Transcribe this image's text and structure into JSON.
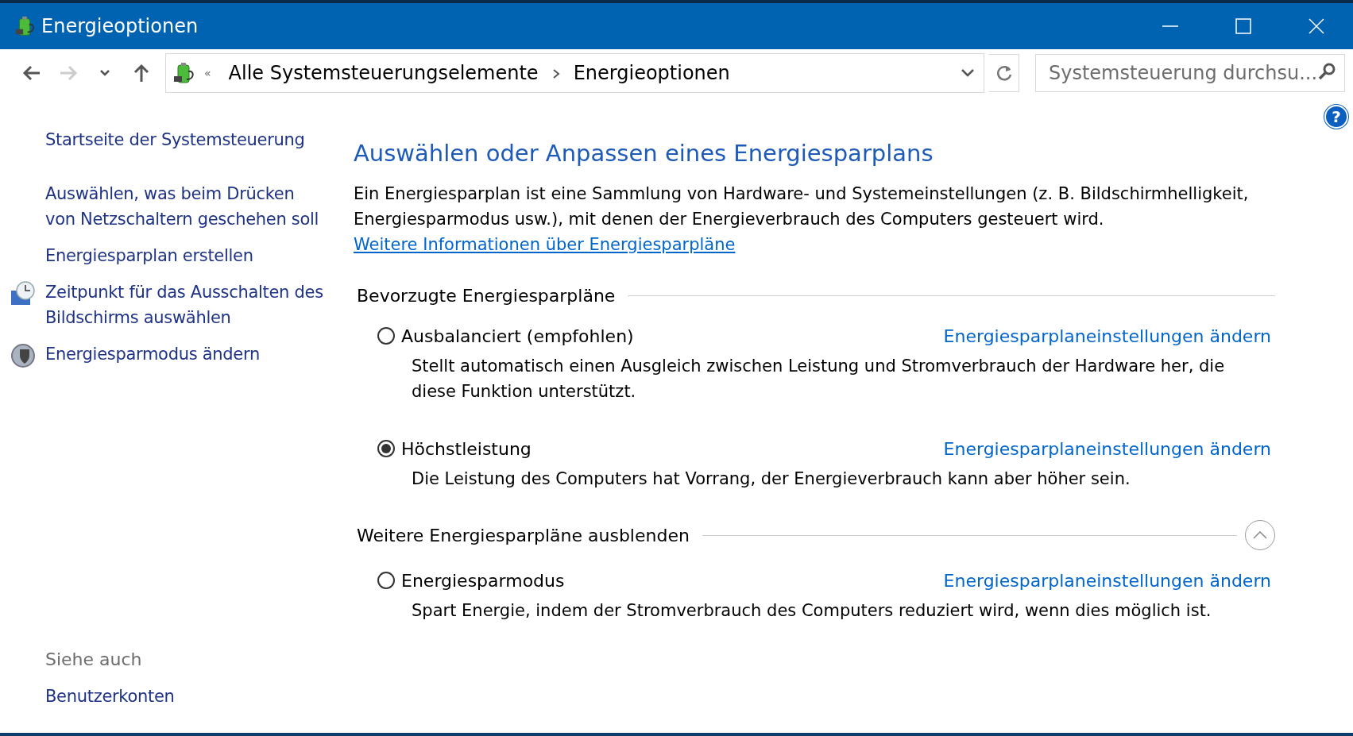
{
  "window": {
    "title": "Energieoptionen"
  },
  "address_bar": {
    "overflow": "«",
    "crumbs": [
      "Alle Systemsteuerungselemente",
      "Energieoptionen"
    ]
  },
  "search": {
    "placeholder": "Systemsteuerung durchsu..."
  },
  "help": {
    "label": "?"
  },
  "sidebar": {
    "items": [
      {
        "label": "Startseite der Systemsteuerung",
        "kind": "link"
      },
      {
        "label": "Auswählen, was beim Drücken von Netzschaltern geschehen soll",
        "kind": "link"
      },
      {
        "label": "Energiesparplan erstellen",
        "kind": "link"
      },
      {
        "label": "Zeitpunkt für das Ausschalten des Bildschirms auswählen",
        "kind": "clock-link"
      },
      {
        "label": "Energiesparmodus ändern",
        "kind": "mode-link"
      }
    ],
    "see_also": {
      "heading": "Siehe auch",
      "items": [
        "Benutzerkonten"
      ]
    }
  },
  "main": {
    "heading": "Auswählen oder Anpassen eines Energiesparplans",
    "intro": "Ein Energiesparplan ist eine Sammlung von Hardware- und Systemeinstellungen (z. B. Bildschirmhelligkeit, Energiesparmodus usw.), mit denen der Energieverbrauch des Computers gesteuert wird. ",
    "intro_link": "Weitere Informationen über Energiesparpläne",
    "groups": [
      {
        "title": "Bevorzugte Energiesparpläne",
        "plans": [
          {
            "name": "Ausbalanciert (empfohlen)",
            "selected": false,
            "link": "Energiesparplaneinstellungen ändern",
            "description": "Stellt automatisch einen Ausgleich zwischen Leistung und Stromverbrauch der Hardware her, die diese Funktion unterstützt."
          },
          {
            "name": "Höchstleistung",
            "selected": true,
            "link": "Energiesparplaneinstellungen ändern",
            "description": "Die Leistung des Computers hat Vorrang, der Energieverbrauch kann aber höher sein."
          }
        ]
      },
      {
        "title": "Weitere Energiesparpläne ausblenden",
        "expanded": true,
        "plans": [
          {
            "name": "Energiesparmodus",
            "selected": false,
            "link": "Energiesparplaneinstellungen ändern",
            "description": "Spart Energie, indem der Stromverbrauch des Computers reduziert wird, wenn dies möglich ist."
          }
        ]
      }
    ]
  }
}
